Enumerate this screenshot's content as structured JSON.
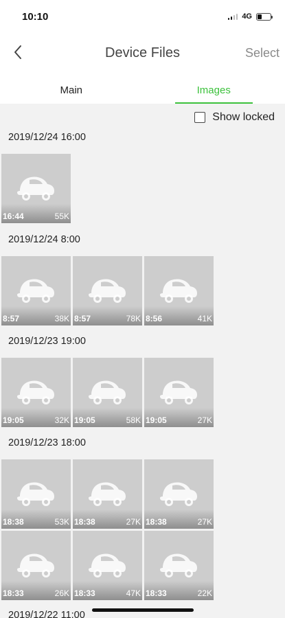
{
  "status_bar": {
    "time": "10:10",
    "network": "4G",
    "battery_icon": "battery-icon",
    "signal_icon": "signal-icon"
  },
  "nav": {
    "back_icon": "chevron-left-icon",
    "title": "Device Files",
    "select_label": "Select"
  },
  "tabs": [
    {
      "label": "Main",
      "active": false
    },
    {
      "label": "Images",
      "active": true
    }
  ],
  "accent_color": "#3cc13c",
  "filter": {
    "show_locked_label": "Show locked",
    "show_locked_checked": false
  },
  "groups": [
    {
      "date": "2019/12/24 16:00",
      "items": [
        {
          "time": "16:44",
          "size": "55K"
        }
      ]
    },
    {
      "date": "2019/12/24 8:00",
      "items": [
        {
          "time": "8:57",
          "size": "38K"
        },
        {
          "time": "8:57",
          "size": "78K"
        },
        {
          "time": "8:56",
          "size": "41K"
        }
      ]
    },
    {
      "date": "2019/12/23 19:00",
      "items": [
        {
          "time": "19:05",
          "size": "32K"
        },
        {
          "time": "19:05",
          "size": "58K"
        },
        {
          "time": "19:05",
          "size": "27K"
        }
      ]
    },
    {
      "date": "2019/12/23 18:00",
      "items": [
        {
          "time": "18:38",
          "size": "53K"
        },
        {
          "time": "18:38",
          "size": "27K"
        },
        {
          "time": "18:38",
          "size": "27K"
        },
        {
          "time": "18:33",
          "size": "26K"
        },
        {
          "time": "18:33",
          "size": "47K"
        },
        {
          "time": "18:33",
          "size": "22K"
        }
      ]
    },
    {
      "date": "2019/12/22 11:00",
      "items": []
    }
  ]
}
